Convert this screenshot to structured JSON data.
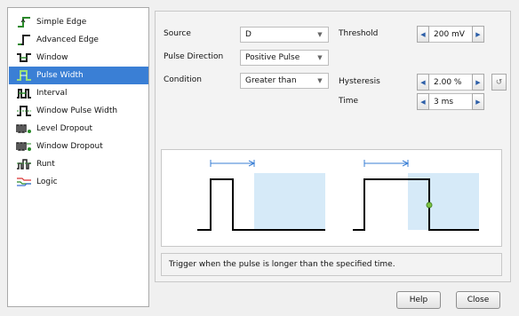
{
  "trigger_types": [
    {
      "label": "Simple Edge",
      "icon": "simple-edge-icon"
    },
    {
      "label": "Advanced Edge",
      "icon": "advanced-edge-icon"
    },
    {
      "label": "Window",
      "icon": "window-icon"
    },
    {
      "label": "Pulse Width",
      "icon": "pulse-width-icon"
    },
    {
      "label": "Interval",
      "icon": "interval-icon"
    },
    {
      "label": "Window Pulse Width",
      "icon": "window-pulse-width-icon"
    },
    {
      "label": "Level Dropout",
      "icon": "level-dropout-icon"
    },
    {
      "label": "Window Dropout",
      "icon": "window-dropout-icon"
    },
    {
      "label": "Runt",
      "icon": "runt-icon"
    },
    {
      "label": "Logic",
      "icon": "logic-icon"
    }
  ],
  "selected_trigger": "Pulse Width",
  "form": {
    "source_label": "Source",
    "source_value": "D",
    "pulse_direction_label": "Pulse Direction",
    "pulse_direction_value": "Positive Pulse",
    "condition_label": "Condition",
    "condition_value": "Greater than",
    "threshold_label": "Threshold",
    "threshold_value": "200 mV",
    "hysteresis_label": "Hysteresis",
    "hysteresis_value": "2.00 %",
    "time_label": "Time",
    "time_value": "3 ms"
  },
  "description": "Trigger when the pulse is longer than the specified time.",
  "buttons": {
    "help": "Help",
    "close": "Close"
  },
  "colors": {
    "selection": "#3a7fd5",
    "window_fill": "#d6eaf8",
    "marker": "#3a7fd5",
    "trigger_point": "#7cc242",
    "waveform": "#000000"
  }
}
